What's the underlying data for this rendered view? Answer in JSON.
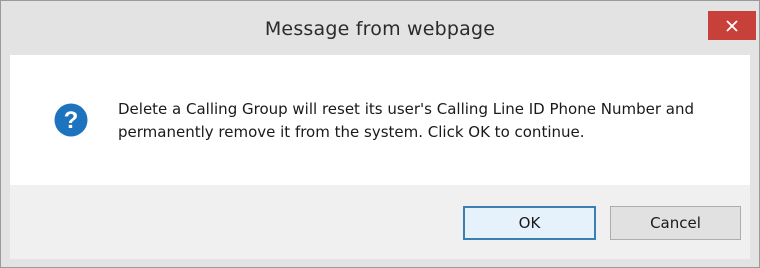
{
  "dialog": {
    "title": "Message from webpage",
    "close_icon": "close-icon",
    "close_color": "#c7403a",
    "icon": "question-icon",
    "icon_color": "#1e73be",
    "message": "Delete a Calling Group will reset its user's Calling Line ID Phone Number and permanently remove it from the system. Click OK to continue.",
    "buttons": {
      "ok_label": "OK",
      "cancel_label": "Cancel"
    }
  }
}
